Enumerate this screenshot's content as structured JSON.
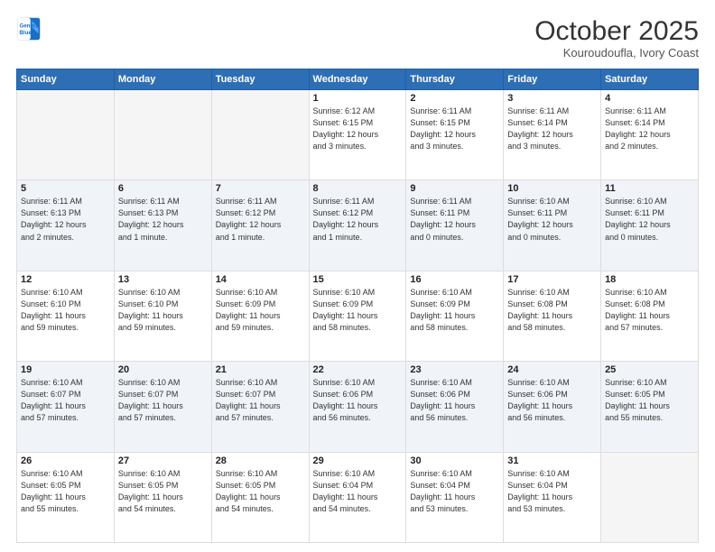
{
  "header": {
    "logo_line1": "General",
    "logo_line2": "Blue",
    "month_title": "October 2025",
    "location": "Kouroudoufla, Ivory Coast"
  },
  "weekdays": [
    "Sunday",
    "Monday",
    "Tuesday",
    "Wednesday",
    "Thursday",
    "Friday",
    "Saturday"
  ],
  "weeks": [
    [
      {
        "day": "",
        "info": ""
      },
      {
        "day": "",
        "info": ""
      },
      {
        "day": "",
        "info": ""
      },
      {
        "day": "1",
        "info": "Sunrise: 6:12 AM\nSunset: 6:15 PM\nDaylight: 12 hours\nand 3 minutes."
      },
      {
        "day": "2",
        "info": "Sunrise: 6:11 AM\nSunset: 6:15 PM\nDaylight: 12 hours\nand 3 minutes."
      },
      {
        "day": "3",
        "info": "Sunrise: 6:11 AM\nSunset: 6:14 PM\nDaylight: 12 hours\nand 3 minutes."
      },
      {
        "day": "4",
        "info": "Sunrise: 6:11 AM\nSunset: 6:14 PM\nDaylight: 12 hours\nand 2 minutes."
      }
    ],
    [
      {
        "day": "5",
        "info": "Sunrise: 6:11 AM\nSunset: 6:13 PM\nDaylight: 12 hours\nand 2 minutes."
      },
      {
        "day": "6",
        "info": "Sunrise: 6:11 AM\nSunset: 6:13 PM\nDaylight: 12 hours\nand 1 minute."
      },
      {
        "day": "7",
        "info": "Sunrise: 6:11 AM\nSunset: 6:12 PM\nDaylight: 12 hours\nand 1 minute."
      },
      {
        "day": "8",
        "info": "Sunrise: 6:11 AM\nSunset: 6:12 PM\nDaylight: 12 hours\nand 1 minute."
      },
      {
        "day": "9",
        "info": "Sunrise: 6:11 AM\nSunset: 6:11 PM\nDaylight: 12 hours\nand 0 minutes."
      },
      {
        "day": "10",
        "info": "Sunrise: 6:10 AM\nSunset: 6:11 PM\nDaylight: 12 hours\nand 0 minutes."
      },
      {
        "day": "11",
        "info": "Sunrise: 6:10 AM\nSunset: 6:11 PM\nDaylight: 12 hours\nand 0 minutes."
      }
    ],
    [
      {
        "day": "12",
        "info": "Sunrise: 6:10 AM\nSunset: 6:10 PM\nDaylight: 11 hours\nand 59 minutes."
      },
      {
        "day": "13",
        "info": "Sunrise: 6:10 AM\nSunset: 6:10 PM\nDaylight: 11 hours\nand 59 minutes."
      },
      {
        "day": "14",
        "info": "Sunrise: 6:10 AM\nSunset: 6:09 PM\nDaylight: 11 hours\nand 59 minutes."
      },
      {
        "day": "15",
        "info": "Sunrise: 6:10 AM\nSunset: 6:09 PM\nDaylight: 11 hours\nand 58 minutes."
      },
      {
        "day": "16",
        "info": "Sunrise: 6:10 AM\nSunset: 6:09 PM\nDaylight: 11 hours\nand 58 minutes."
      },
      {
        "day": "17",
        "info": "Sunrise: 6:10 AM\nSunset: 6:08 PM\nDaylight: 11 hours\nand 58 minutes."
      },
      {
        "day": "18",
        "info": "Sunrise: 6:10 AM\nSunset: 6:08 PM\nDaylight: 11 hours\nand 57 minutes."
      }
    ],
    [
      {
        "day": "19",
        "info": "Sunrise: 6:10 AM\nSunset: 6:07 PM\nDaylight: 11 hours\nand 57 minutes."
      },
      {
        "day": "20",
        "info": "Sunrise: 6:10 AM\nSunset: 6:07 PM\nDaylight: 11 hours\nand 57 minutes."
      },
      {
        "day": "21",
        "info": "Sunrise: 6:10 AM\nSunset: 6:07 PM\nDaylight: 11 hours\nand 57 minutes."
      },
      {
        "day": "22",
        "info": "Sunrise: 6:10 AM\nSunset: 6:06 PM\nDaylight: 11 hours\nand 56 minutes."
      },
      {
        "day": "23",
        "info": "Sunrise: 6:10 AM\nSunset: 6:06 PM\nDaylight: 11 hours\nand 56 minutes."
      },
      {
        "day": "24",
        "info": "Sunrise: 6:10 AM\nSunset: 6:06 PM\nDaylight: 11 hours\nand 56 minutes."
      },
      {
        "day": "25",
        "info": "Sunrise: 6:10 AM\nSunset: 6:05 PM\nDaylight: 11 hours\nand 55 minutes."
      }
    ],
    [
      {
        "day": "26",
        "info": "Sunrise: 6:10 AM\nSunset: 6:05 PM\nDaylight: 11 hours\nand 55 minutes."
      },
      {
        "day": "27",
        "info": "Sunrise: 6:10 AM\nSunset: 6:05 PM\nDaylight: 11 hours\nand 54 minutes."
      },
      {
        "day": "28",
        "info": "Sunrise: 6:10 AM\nSunset: 6:05 PM\nDaylight: 11 hours\nand 54 minutes."
      },
      {
        "day": "29",
        "info": "Sunrise: 6:10 AM\nSunset: 6:04 PM\nDaylight: 11 hours\nand 54 minutes."
      },
      {
        "day": "30",
        "info": "Sunrise: 6:10 AM\nSunset: 6:04 PM\nDaylight: 11 hours\nand 53 minutes."
      },
      {
        "day": "31",
        "info": "Sunrise: 6:10 AM\nSunset: 6:04 PM\nDaylight: 11 hours\nand 53 minutes."
      },
      {
        "day": "",
        "info": ""
      }
    ]
  ]
}
